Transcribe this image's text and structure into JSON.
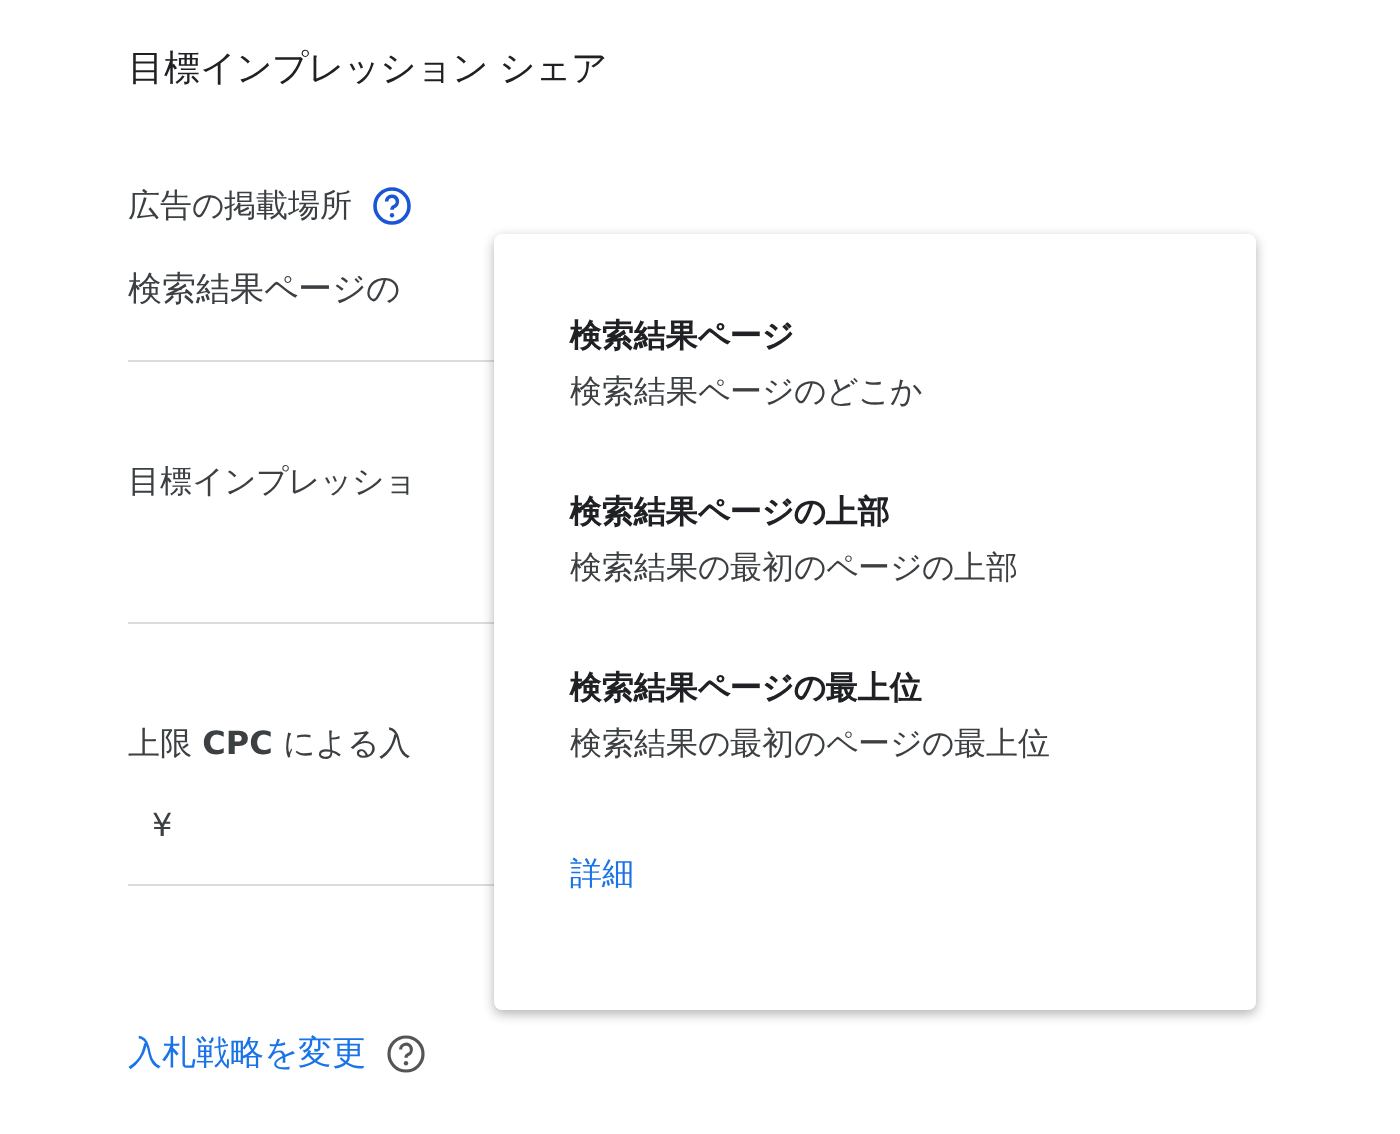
{
  "title": "目標インプレッション シェア",
  "placement": {
    "label": "広告の掲載場所",
    "value": "検索結果ページの"
  },
  "fields": [
    {
      "label": "目標インプレッショ"
    },
    {
      "label": "上限 **CPC** による入",
      "value": "¥"
    }
  ],
  "link": "入札戦略を変更",
  "popup": {
    "options": [
      {
        "title": "検索結果ページ",
        "description": "検索結果ページのどこか"
      },
      {
        "title": "検索結果ページの上部",
        "description": "検索結果の最初のページの上部"
      },
      {
        "title": "検索結果ページの最上位",
        "description": "検索結果の最初のページの最上位"
      }
    ],
    "link": "詳細"
  }
}
